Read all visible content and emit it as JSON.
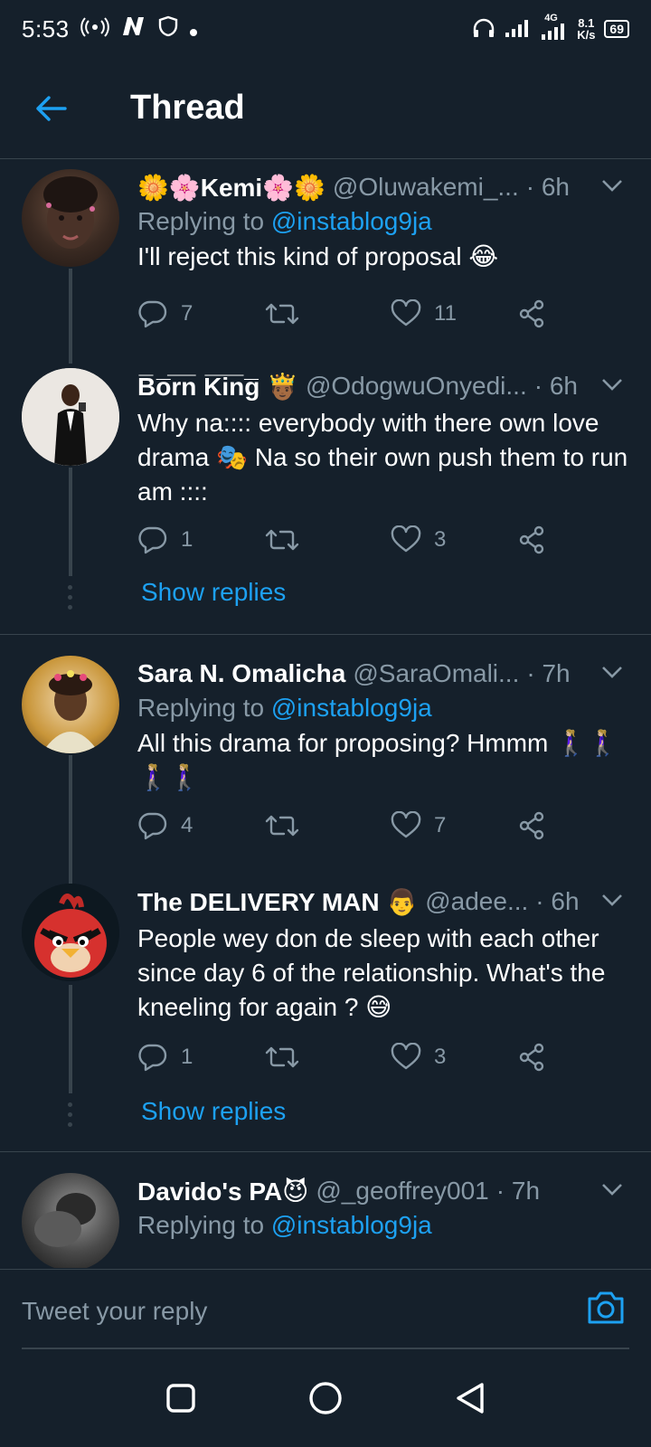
{
  "status": {
    "time": "5:53",
    "net_speed_value": "8.1",
    "net_speed_unit": "K/s",
    "signal_label": "4G",
    "battery": "69"
  },
  "header": {
    "title": "Thread"
  },
  "tweets": [
    {
      "name": "🌼🌸Kemi🌸🌼",
      "handle": "@Oluwakemi_...",
      "time": "· 6h",
      "reply_prefix": "Replying to",
      "reply_handle": "@instablog9ja",
      "text": "I'll reject this kind of proposal 😂",
      "reply_count": "7",
      "retweet_count": "",
      "like_count": "11"
    },
    {
      "name": "B̅o̅r̅n̅ K̅i̅n̅g̅ 🤴🏾",
      "handle": "@OdogwuOnyedi...",
      "time": "· 6h",
      "text": "Why na:::: everybody with there own love drama 🎭 Na so their own push them to run am ::::",
      "reply_count": "1",
      "retweet_count": "",
      "like_count": "3",
      "show_replies": "Show replies"
    },
    {
      "name": "Sara N. Omalicha",
      "handle": "@SaraOmali...",
      "time": "· 7h",
      "reply_prefix": "Replying to",
      "reply_handle": "@instablog9ja",
      "text": "All this drama for proposing? Hmmm 🚶🏼‍♀️🚶🏼‍♀️🚶🏼‍♀️🚶🏼‍♀️",
      "reply_count": "4",
      "retweet_count": "",
      "like_count": "7"
    },
    {
      "name": "The DELIVERY MAN 👨",
      "handle": "@adee...",
      "time": "· 6h",
      "text": "People wey don de sleep with each other since day 6 of the relationship.   What's the kneeling for again ? 😅",
      "reply_count": "1",
      "retweet_count": "",
      "like_count": "3",
      "show_replies": "Show replies"
    },
    {
      "name": "Davido's PA😈",
      "handle": "@_geoffrey001",
      "time": "· 7h",
      "reply_prefix": "Replying to",
      "reply_handle": "@instablog9ja"
    }
  ],
  "composer": {
    "placeholder": "Tweet your reply"
  },
  "colors": {
    "background": "#15202b",
    "accent": "#1da1f2",
    "muted": "#8899a6",
    "divider": "#38444d"
  },
  "icons": [
    "wifi-calling-icon",
    "n-app-icon",
    "shield-icon",
    "headphones-icon",
    "signal-icon",
    "battery-icon",
    "back-arrow-icon",
    "chevron-down-icon",
    "reply-icon",
    "retweet-icon",
    "like-icon",
    "share-icon",
    "camera-icon",
    "home-square-icon",
    "circle-home-icon",
    "back-triangle-icon"
  ]
}
